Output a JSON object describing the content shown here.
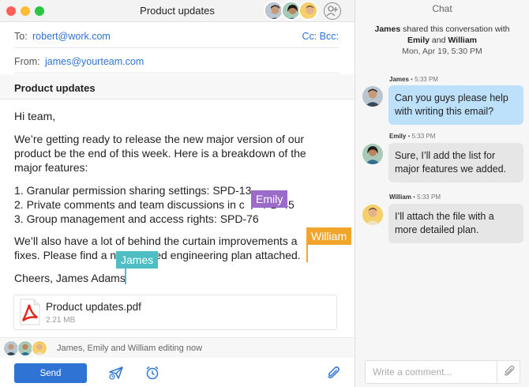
{
  "window": {
    "title": "Product updates"
  },
  "compose": {
    "to_label": "To:",
    "to_value": "robert@work.com",
    "cc_bcc": "Cc: Bcc:",
    "from_label": "From:",
    "from_value": "james@yourteam.com",
    "subject": "Product updates",
    "body": {
      "greeting": "Hi team,",
      "para1": [
        "We’re getting ready to release the new major version of our",
        "product be the end of this week. Here is a breakdown of the",
        "major features:"
      ],
      "list": [
        "1. Granular permission sharing settings: SPD-13",
        "2. Private comments and team discussions in c      PD-45",
        "3. Group management and access rights: SPD-76"
      ],
      "para2": [
        "We’ll also have a lot of behind the curtain improvements a",
        "fixes. Please find a n           iled engineering plan attached."
      ],
      "signoff": "Cheers, James Adams"
    },
    "cursors": [
      {
        "name": "Emily",
        "color": "#9b6bc9"
      },
      {
        "name": "William",
        "color": "#f2a52b"
      },
      {
        "name": "James",
        "color": "#4dbfc4"
      }
    ],
    "attachment": {
      "name": "Product updates.pdf",
      "size": "2.21 MB",
      "icon": "pdf-icon"
    },
    "editing_status": "James, Emily and William editing now",
    "send_label": "Send",
    "icons": [
      "send-later-icon",
      "alarm-clock-icon",
      "paperclip-icon"
    ]
  },
  "chat": {
    "title": "Chat",
    "shared": {
      "actor": "James",
      "action": " shared this conversation with",
      "target1": "Emily",
      "conj": " and ",
      "target2": "William",
      "date": "Mon, Apr 19, 5:30 PM"
    },
    "messages": [
      {
        "author": "James",
        "time": " • 5:33 PM",
        "text": "Can you guys please help with writing this email?",
        "style": "blue"
      },
      {
        "author": "Emily",
        "time": " • 5:33 PM",
        "text": "Sure, I’ll add the list for major features we added.",
        "style": "grey"
      },
      {
        "author": "William",
        "time": " • 5:33 PM",
        "text": "I’ll attach the file with a more detailed plan.",
        "style": "grey"
      }
    ],
    "comment_placeholder": "Write a comment..."
  },
  "colors": {
    "accent": "#2f73d4",
    "james_bubble": "#bde0fb",
    "other_bubble": "#e6e6e6"
  }
}
